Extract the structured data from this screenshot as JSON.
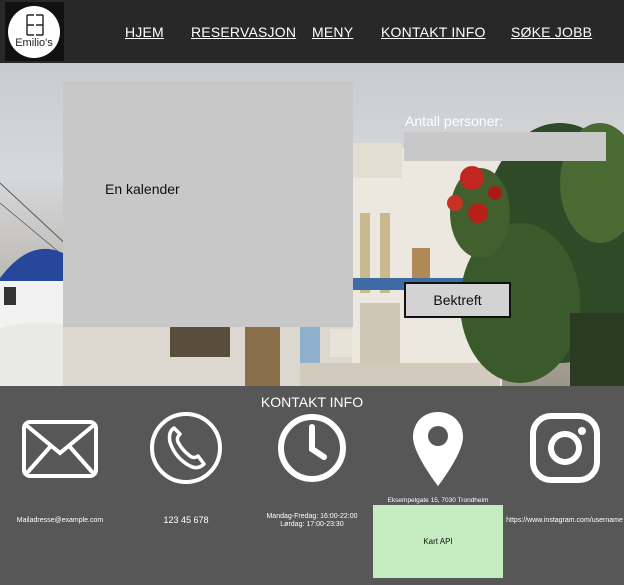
{
  "logo": {
    "text": "Emilio's"
  },
  "nav": {
    "home": "HJEM",
    "reservation": "RESERVASJON",
    "menu": "MENY",
    "contact": "KONTAKT INFO",
    "jobs": "SØKE JOBB"
  },
  "reservation": {
    "calendar_placeholder": "En kalender",
    "persons_label": "Antall personer:",
    "persons_value": "",
    "confirm_label": "Bektreft"
  },
  "contact": {
    "title": "KONTAKT INFO",
    "email": "Mailadresse@example.com",
    "phone": "123 45 678",
    "hours_weekdays": "Mandag-Fredag: 16:00-22:00",
    "hours_saturday": "Lørdag: 17:00-23:30",
    "address": "Eksempelgate 15, 7030 Trondheim",
    "map_label": "Kart API",
    "instagram": "https://www.instagram.com/username"
  },
  "icons": {
    "email": "envelope-icon",
    "phone": "phone-icon",
    "hours": "clock-icon",
    "location": "map-pin-icon",
    "instagram": "instagram-icon"
  },
  "colors": {
    "header_bg": "#282828",
    "footer_bg": "#575757",
    "placeholder_gray": "#c8c8c8",
    "map_green": "#c5ecc0"
  }
}
